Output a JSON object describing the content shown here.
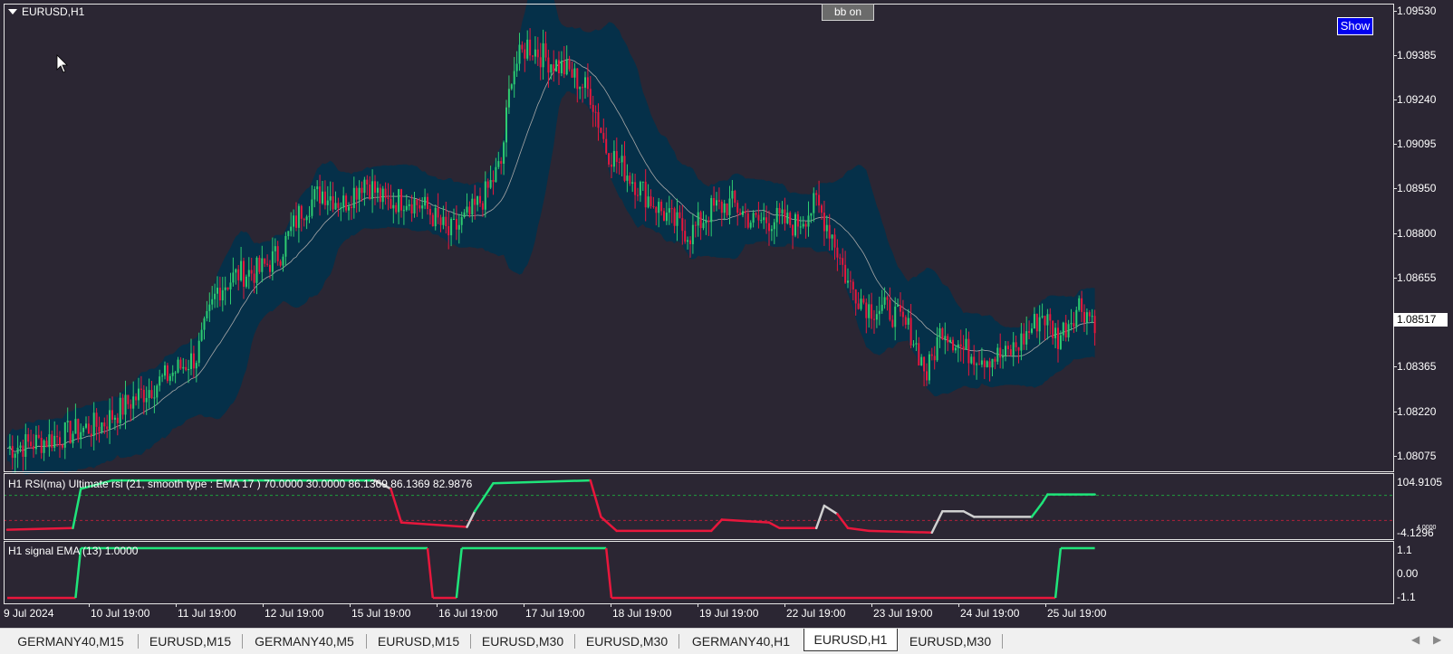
{
  "window": {
    "symbol_title": "EURUSD,H1"
  },
  "buttons": {
    "bb_label": "bb on",
    "show_label": "Show"
  },
  "price_axis": {
    "labels": [
      "1.09530",
      "1.09385",
      "1.09240",
      "1.09095",
      "1.08950",
      "1.08800",
      "1.08655",
      "1.08365",
      "1.08220",
      "1.08075"
    ],
    "current_price": "1.08517"
  },
  "rsi_pane": {
    "title": "H1 RSI(ma) Ultimate rsi (21, smooth type : EMA  17 ) 70.0000 30.0000 86.1369 86.1369 82.9876",
    "axis_max": "104.9105",
    "axis_min": "-4.1296",
    "axis_extra": "4.0000"
  },
  "signal_pane": {
    "title": "H1 signal EMA (13) 1.0000",
    "axis_labels": [
      "1.1",
      "0.00",
      "-1.1"
    ]
  },
  "time_axis": {
    "labels": [
      "9 Jul 2024",
      "10 Jul 19:00",
      "11 Jul 19:00",
      "12 Jul 19:00",
      "15 Jul 19:00",
      "16 Jul 19:00",
      "17 Jul 19:00",
      "18 Jul 19:00",
      "19 Jul 19:00",
      "22 Jul 19:00",
      "23 Jul 19:00",
      "24 Jul 19:00",
      "25 Jul 19:00"
    ]
  },
  "tabs": [
    {
      "label": "GERMANY40,M15",
      "active": false
    },
    {
      "label": "EURUSD,M15",
      "active": false
    },
    {
      "label": "GERMANY40,M5",
      "active": false
    },
    {
      "label": "EURUSD,M15",
      "active": false
    },
    {
      "label": "EURUSD,M30",
      "active": false
    },
    {
      "label": "EURUSD,M30",
      "active": false
    },
    {
      "label": "GERMANY40,H1",
      "active": false
    },
    {
      "label": "EURUSD,H1",
      "active": true
    },
    {
      "label": "EURUSD,M30",
      "active": false
    }
  ],
  "colors": {
    "background": "#2b2633",
    "bollinger_fill": "#053049",
    "bull_candle": "#2ecc71",
    "bear_candle": "#e8173c",
    "rsi_up": "#1fe47a",
    "rsi_down": "#e8173c",
    "rsi_neutral": "#d0d0d0",
    "ma_line": "#a8a8a8"
  },
  "chart_data": {
    "type": "candlestick",
    "price_path": [
      [
        0,
        1.081
      ],
      [
        12,
        1.0812
      ],
      [
        24,
        1.0815
      ],
      [
        36,
        1.0818
      ],
      [
        48,
        1.0826
      ],
      [
        60,
        1.0833
      ],
      [
        72,
        1.084
      ],
      [
        80,
        1.0862
      ],
      [
        88,
        1.0867
      ],
      [
        96,
        1.0868
      ],
      [
        104,
        1.0874
      ],
      [
        112,
        1.0888
      ],
      [
        120,
        1.0894
      ],
      [
        128,
        1.089
      ],
      [
        136,
        1.0898
      ],
      [
        144,
        1.089
      ],
      [
        152,
        1.0892
      ],
      [
        160,
        1.0888
      ],
      [
        168,
        1.088
      ],
      [
        176,
        1.0886
      ],
      [
        182,
        1.0893
      ],
      [
        188,
        1.0903
      ],
      [
        192,
        1.0933
      ],
      [
        198,
        1.0942
      ],
      [
        206,
        1.0937
      ],
      [
        214,
        1.0933
      ],
      [
        222,
        1.0926
      ],
      [
        228,
        1.0908
      ],
      [
        236,
        1.09
      ],
      [
        244,
        1.0892
      ],
      [
        252,
        1.0885
      ],
      [
        260,
        1.088
      ],
      [
        268,
        1.0888
      ],
      [
        276,
        1.089
      ],
      [
        284,
        1.0884
      ],
      [
        292,
        1.0885
      ],
      [
        300,
        1.0883
      ],
      [
        308,
        1.089
      ],
      [
        314,
        1.088
      ],
      [
        320,
        1.0864
      ],
      [
        328,
        1.0856
      ],
      [
        336,
        1.0855
      ],
      [
        344,
        1.0848
      ],
      [
        350,
        1.0834
      ],
      [
        356,
        1.085
      ],
      [
        364,
        1.0842
      ],
      [
        372,
        1.084
      ],
      [
        380,
        1.084
      ],
      [
        386,
        1.0845
      ],
      [
        394,
        1.0854
      ],
      [
        400,
        1.0846
      ],
      [
        408,
        1.0857
      ],
      [
        414,
        1.0852
      ]
    ],
    "rsi_path": [
      [
        0,
        7,
        "down"
      ],
      [
        25,
        10,
        "down"
      ],
      [
        28,
        80,
        "up"
      ],
      [
        40,
        95,
        "up"
      ],
      [
        140,
        95,
        "up"
      ],
      [
        146,
        80,
        "neutral"
      ],
      [
        150,
        20,
        "down"
      ],
      [
        175,
        12,
        "down"
      ],
      [
        178,
        40,
        "neutral"
      ],
      [
        185,
        90,
        "up"
      ],
      [
        222,
        95,
        "up"
      ],
      [
        226,
        30,
        "down"
      ],
      [
        232,
        5,
        "down"
      ],
      [
        268,
        5,
        "down"
      ],
      [
        272,
        25,
        "down"
      ],
      [
        290,
        20,
        "down"
      ],
      [
        294,
        10,
        "down"
      ],
      [
        308,
        10,
        "down"
      ],
      [
        311,
        50,
        "neutral"
      ],
      [
        316,
        35,
        "neutral"
      ],
      [
        320,
        10,
        "down"
      ],
      [
        328,
        5,
        "down"
      ],
      [
        352,
        2,
        "down"
      ],
      [
        356,
        40,
        "neutral"
      ],
      [
        364,
        40,
        "neutral"
      ],
      [
        368,
        30,
        "neutral"
      ],
      [
        390,
        30,
        "neutral"
      ],
      [
        394,
        55,
        "up"
      ],
      [
        396,
        70,
        "up"
      ],
      [
        414,
        70,
        "up"
      ]
    ],
    "signal_segments": [
      [
        0,
        -1.1,
        26,
        -1.1,
        "down"
      ],
      [
        26,
        -1.1,
        28,
        1.1,
        "up"
      ],
      [
        28,
        1.1,
        160,
        1.1,
        "up"
      ],
      [
        160,
        1.1,
        162,
        -1.1,
        "down"
      ],
      [
        162,
        -1.1,
        171,
        -1.1,
        "down"
      ],
      [
        171,
        -1.1,
        173,
        1.1,
        "up"
      ],
      [
        173,
        1.1,
        228,
        1.1,
        "up"
      ],
      [
        228,
        1.1,
        230,
        -1.1,
        "down"
      ],
      [
        230,
        -1.1,
        399,
        -1.1,
        "down"
      ],
      [
        399,
        -1.1,
        401,
        1.1,
        "up"
      ],
      [
        401,
        1.1,
        414,
        1.1,
        "up"
      ]
    ]
  }
}
